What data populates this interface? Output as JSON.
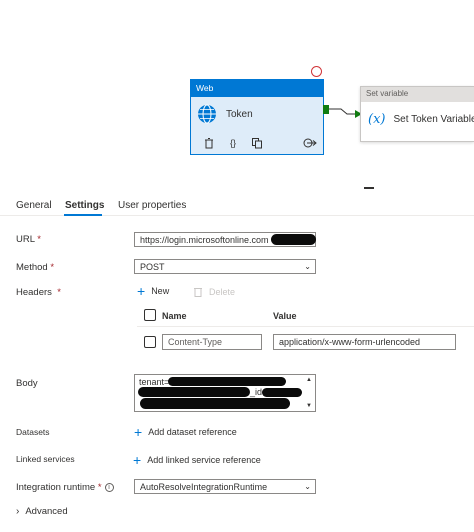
{
  "canvas": {
    "web_activity": {
      "type_label": "Web",
      "name": "Token"
    },
    "setvar_activity": {
      "type_label": "Set variable",
      "icon_glyph": "(x)",
      "name": "Set Token Variable"
    }
  },
  "tabs": [
    {
      "label": "General"
    },
    {
      "label": "Settings"
    },
    {
      "label": "User properties"
    }
  ],
  "form": {
    "url": {
      "label": "URL",
      "required_mark": "*",
      "value": "https://login.microsoftonline.com"
    },
    "method": {
      "label": "Method",
      "required_mark": "*",
      "value": "POST"
    },
    "headers": {
      "label": "Headers",
      "required_mark": "*",
      "new_label": "New",
      "delete_label": "Delete",
      "col_name": "Name",
      "col_value": "Value",
      "rows": [
        {
          "name": "Content-Type",
          "value": "application/x-www-form-urlencoded"
        }
      ]
    },
    "body": {
      "label": "Body",
      "value_prefix": "tenant=",
      "line2_suffix": "_id="
    },
    "datasets": {
      "label": "Datasets",
      "action": "Add dataset reference"
    },
    "linked_services": {
      "label": "Linked services",
      "action": "Add linked service reference"
    },
    "runtime": {
      "label": "Integration runtime",
      "required_mark": "*",
      "value": "AutoResolveIntegrationRuntime"
    },
    "advanced": {
      "label": "Advanced"
    }
  },
  "colors": {
    "accent": "#0078d4",
    "error": "#d13438",
    "success": "#107c10"
  },
  "icons": [
    "globe-icon",
    "delete-icon",
    "code-icon",
    "copy-icon",
    "output-arrow-icon",
    "plus-icon",
    "trash-icon",
    "chevron-down-icon",
    "info-icon",
    "chevron-right-icon"
  ]
}
